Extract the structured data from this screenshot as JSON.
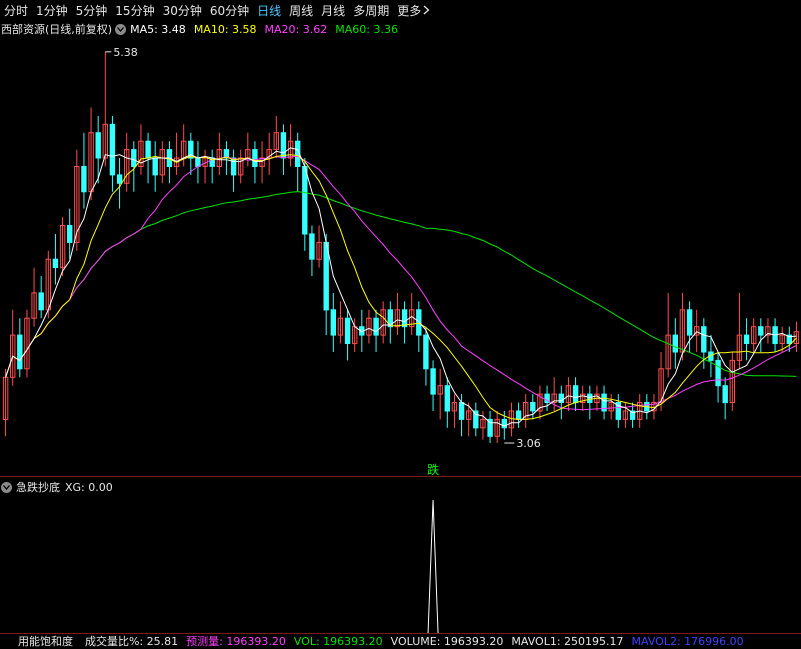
{
  "period_bar": {
    "tabs": [
      {
        "label": "分时",
        "active": false
      },
      {
        "label": "1分钟",
        "active": false
      },
      {
        "label": "5分钟",
        "active": false
      },
      {
        "label": "15分钟",
        "active": false
      },
      {
        "label": "30分钟",
        "active": false
      },
      {
        "label": "60分钟",
        "active": false
      },
      {
        "label": "日线",
        "active": true
      },
      {
        "label": "周线",
        "active": false
      },
      {
        "label": "月线",
        "active": false
      },
      {
        "label": "多周期",
        "active": false
      },
      {
        "label": "更多",
        "active": false
      }
    ],
    "more_icon": "chevron-right-icon"
  },
  "main_header": {
    "title": "西部资源(日线,前复权)",
    "ma5": "MA5: 3.48",
    "ma10": "MA10: 3.58",
    "ma20": "MA20: 3.62",
    "ma60": "MA60: 3.36"
  },
  "sub_header": {
    "title": "急跌抄底",
    "xg": "XG: 0.00"
  },
  "bottom_header": {
    "title": "用能饱和度",
    "ratio": "成交量比%: 25.81",
    "est": "预测量: 196393.20",
    "vol": "VOL: 196393.20",
    "volume": "VOLUME: 196393.20",
    "mavol1": "MAVOL1: 250195.17",
    "mavol2": "MAVOL2: 176996.00"
  },
  "colors": {
    "up": "#ff4d4d",
    "down": "#35ffff",
    "ma5": "#ffffff",
    "ma10": "#ffff00",
    "ma20": "#ff40ff",
    "ma60": "#00e600",
    "signal": "#ffffff",
    "signal_text": "#00ff00",
    "active_tab": "#49c8ff"
  },
  "chart_data": {
    "type": "candlestick",
    "ylim": [
      2.9,
      5.45
    ],
    "annotations": {
      "high": {
        "label": "5.38",
        "value": 5.38,
        "index": 14
      },
      "low": {
        "label": "3.06",
        "value": 3.06,
        "index": 70
      },
      "signal": {
        "label": "跌",
        "index": 60
      }
    },
    "candles": [
      [
        3.2,
        3.45,
        3.1,
        3.5
      ],
      [
        3.45,
        3.7,
        3.4,
        3.85
      ],
      [
        3.7,
        3.5,
        3.45,
        3.8
      ],
      [
        3.5,
        3.8,
        3.45,
        3.85
      ],
      [
        3.8,
        3.95,
        3.75,
        4.1
      ],
      [
        3.95,
        3.85,
        3.8,
        4.05
      ],
      [
        3.85,
        4.15,
        3.8,
        4.2
      ],
      [
        4.15,
        4.1,
        4.0,
        4.3
      ],
      [
        4.1,
        4.35,
        4.05,
        4.4
      ],
      [
        4.35,
        4.25,
        4.15,
        4.45
      ],
      [
        4.25,
        4.7,
        4.2,
        4.8
      ],
      [
        4.7,
        4.55,
        4.45,
        4.9
      ],
      [
        4.55,
        4.9,
        4.5,
        5.05
      ],
      [
        4.9,
        4.75,
        4.6,
        5.0
      ],
      [
        4.75,
        4.95,
        4.7,
        5.38
      ],
      [
        4.95,
        4.65,
        4.55,
        5.0
      ],
      [
        4.65,
        4.6,
        4.45,
        4.75
      ],
      [
        4.6,
        4.8,
        4.55,
        4.9
      ],
      [
        4.8,
        4.7,
        4.55,
        4.85
      ],
      [
        4.7,
        4.85,
        4.65,
        4.95
      ],
      [
        4.85,
        4.75,
        4.6,
        4.9
      ],
      [
        4.75,
        4.65,
        4.55,
        4.85
      ],
      [
        4.65,
        4.8,
        4.6,
        4.85
      ],
      [
        4.8,
        4.7,
        4.6,
        4.85
      ],
      [
        4.7,
        4.75,
        4.65,
        4.9
      ],
      [
        4.75,
        4.85,
        4.7,
        4.95
      ],
      [
        4.85,
        4.75,
        4.65,
        4.9
      ],
      [
        4.75,
        4.7,
        4.6,
        4.85
      ],
      [
        4.7,
        4.75,
        4.6,
        4.8
      ],
      [
        4.75,
        4.7,
        4.6,
        4.8
      ],
      [
        4.7,
        4.8,
        4.65,
        4.9
      ],
      [
        4.8,
        4.75,
        4.65,
        4.85
      ],
      [
        4.75,
        4.65,
        4.55,
        4.8
      ],
      [
        4.65,
        4.75,
        4.6,
        4.8
      ],
      [
        4.75,
        4.8,
        4.7,
        4.9
      ],
      [
        4.8,
        4.7,
        4.6,
        4.85
      ],
      [
        4.7,
        4.75,
        4.6,
        4.85
      ],
      [
        4.75,
        4.8,
        4.65,
        4.9
      ],
      [
        4.8,
        4.9,
        4.75,
        5.0
      ],
      [
        4.9,
        4.75,
        4.65,
        4.95
      ],
      [
        4.75,
        4.85,
        4.7,
        4.95
      ],
      [
        4.85,
        4.7,
        4.55,
        4.9
      ],
      [
        4.7,
        4.3,
        4.2,
        4.75
      ],
      [
        4.3,
        4.15,
        4.05,
        4.35
      ],
      [
        4.15,
        4.25,
        4.1,
        4.35
      ],
      [
        4.25,
        3.85,
        3.7,
        4.3
      ],
      [
        3.85,
        3.7,
        3.6,
        3.95
      ],
      [
        3.7,
        3.8,
        3.65,
        3.9
      ],
      [
        3.8,
        3.65,
        3.55,
        3.85
      ],
      [
        3.65,
        3.75,
        3.6,
        3.8
      ],
      [
        3.75,
        3.7,
        3.6,
        3.85
      ],
      [
        3.7,
        3.8,
        3.65,
        3.85
      ],
      [
        3.8,
        3.7,
        3.6,
        3.85
      ],
      [
        3.7,
        3.85,
        3.65,
        3.9
      ],
      [
        3.85,
        3.75,
        3.65,
        3.9
      ],
      [
        3.75,
        3.85,
        3.7,
        3.95
      ],
      [
        3.85,
        3.75,
        3.65,
        3.9
      ],
      [
        3.75,
        3.85,
        3.7,
        3.95
      ],
      [
        3.85,
        3.7,
        3.6,
        3.9
      ],
      [
        3.7,
        3.5,
        3.4,
        3.75
      ],
      [
        3.5,
        3.35,
        3.25,
        3.55
      ],
      [
        3.35,
        3.4,
        3.2,
        3.5
      ],
      [
        3.4,
        3.25,
        3.15,
        3.45
      ],
      [
        3.25,
        3.3,
        3.15,
        3.35
      ],
      [
        3.3,
        3.2,
        3.1,
        3.35
      ],
      [
        3.2,
        3.25,
        3.1,
        3.3
      ],
      [
        3.25,
        3.15,
        3.1,
        3.3
      ],
      [
        3.15,
        3.2,
        3.08,
        3.25
      ],
      [
        3.2,
        3.1,
        3.06,
        3.25
      ],
      [
        3.1,
        3.2,
        3.06,
        3.25
      ],
      [
        3.2,
        3.15,
        3.08,
        3.25
      ],
      [
        3.15,
        3.25,
        3.1,
        3.3
      ],
      [
        3.25,
        3.2,
        3.15,
        3.3
      ],
      [
        3.2,
        3.3,
        3.15,
        3.35
      ],
      [
        3.3,
        3.25,
        3.2,
        3.35
      ],
      [
        3.25,
        3.35,
        3.2,
        3.4
      ],
      [
        3.35,
        3.3,
        3.25,
        3.4
      ],
      [
        3.3,
        3.35,
        3.25,
        3.45
      ],
      [
        3.35,
        3.3,
        3.2,
        3.4
      ],
      [
        3.3,
        3.4,
        3.25,
        3.45
      ],
      [
        3.4,
        3.3,
        3.25,
        3.45
      ],
      [
        3.3,
        3.35,
        3.25,
        3.4
      ],
      [
        3.35,
        3.3,
        3.2,
        3.4
      ],
      [
        3.3,
        3.35,
        3.25,
        3.4
      ],
      [
        3.35,
        3.25,
        3.2,
        3.4
      ],
      [
        3.25,
        3.3,
        3.2,
        3.35
      ],
      [
        3.3,
        3.2,
        3.15,
        3.35
      ],
      [
        3.2,
        3.25,
        3.15,
        3.3
      ],
      [
        3.25,
        3.2,
        3.15,
        3.3
      ],
      [
        3.2,
        3.3,
        3.15,
        3.35
      ],
      [
        3.3,
        3.25,
        3.2,
        3.35
      ],
      [
        3.25,
        3.3,
        3.2,
        3.35
      ],
      [
        3.3,
        3.5,
        3.25,
        3.6
      ],
      [
        3.5,
        3.7,
        3.45,
        3.95
      ],
      [
        3.7,
        3.6,
        3.5,
        3.8
      ],
      [
        3.6,
        3.85,
        3.55,
        3.95
      ],
      [
        3.85,
        3.7,
        3.6,
        3.9
      ],
      [
        3.7,
        3.75,
        3.6,
        3.85
      ],
      [
        3.75,
        3.6,
        3.5,
        3.8
      ],
      [
        3.6,
        3.55,
        3.45,
        3.7
      ],
      [
        3.55,
        3.4,
        3.3,
        3.6
      ],
      [
        3.4,
        3.3,
        3.2,
        3.45
      ],
      [
        3.3,
        3.55,
        3.25,
        3.6
      ],
      [
        3.55,
        3.7,
        3.5,
        3.95
      ],
      [
        3.7,
        3.65,
        3.55,
        3.8
      ],
      [
        3.65,
        3.75,
        3.6,
        3.8
      ],
      [
        3.75,
        3.7,
        3.6,
        3.8
      ],
      [
        3.7,
        3.75,
        3.65,
        3.8
      ],
      [
        3.75,
        3.65,
        3.6,
        3.8
      ],
      [
        3.65,
        3.7,
        3.6,
        3.75
      ],
      [
        3.7,
        3.65,
        3.6,
        3.75
      ],
      [
        3.65,
        3.72,
        3.6,
        3.78
      ]
    ]
  }
}
